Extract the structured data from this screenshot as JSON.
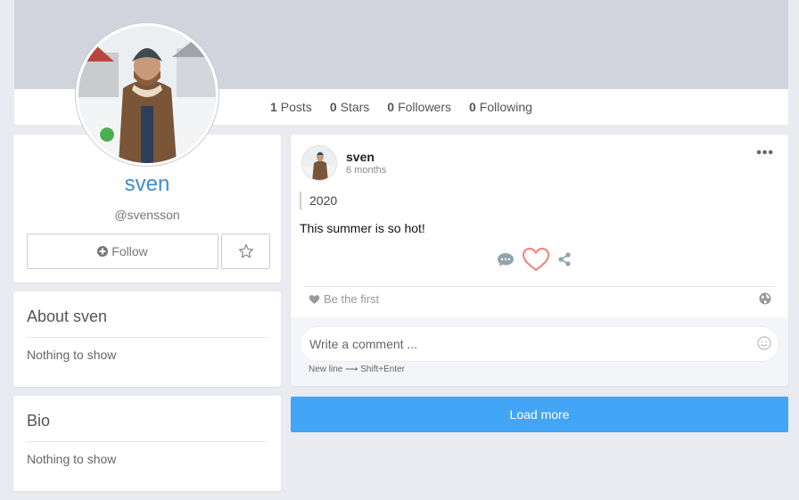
{
  "profile": {
    "name": "sven",
    "handle": "@svensson",
    "follow_label": "Follow",
    "online_color": "#4caf50"
  },
  "stats": [
    {
      "count": "1",
      "label": "Posts"
    },
    {
      "count": "0",
      "label": "Stars"
    },
    {
      "count": "0",
      "label": "Followers"
    },
    {
      "count": "0",
      "label": "Following"
    }
  ],
  "about": {
    "title": "About sven",
    "empty": "Nothing to show"
  },
  "bio": {
    "title": "Bio",
    "empty": "Nothing to show"
  },
  "post": {
    "author": "sven",
    "time": "6 months",
    "quote": "2020",
    "text": "This summer is so hot!",
    "likes_text": "Be the first",
    "comment_placeholder": "Write a comment ...",
    "hint": "New line ⟶ Shift+Enter"
  },
  "load_more_label": "Load more",
  "colors": {
    "accent": "#42a5f5",
    "name": "#3d8ec9",
    "heart": "#f08080"
  }
}
